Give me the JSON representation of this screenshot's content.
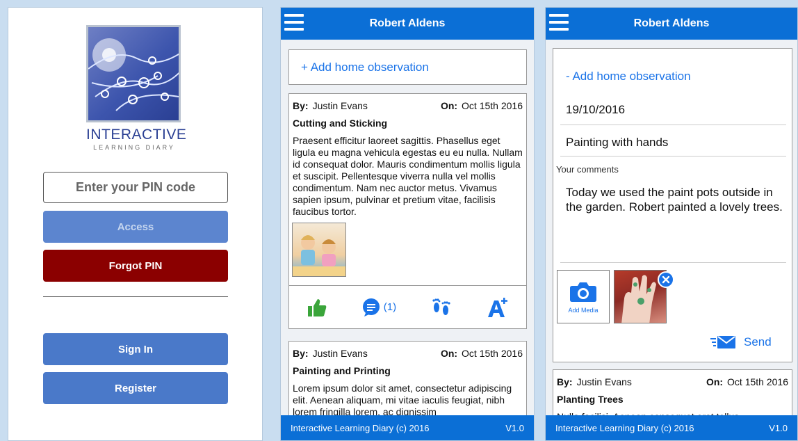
{
  "login": {
    "logo_title": "INTERACTIVE",
    "logo_subtitle": "LEARNING DIARY",
    "pin_placeholder": "Enter your PIN code",
    "access_label": "Access",
    "forgot_label": "Forgot PIN",
    "signin_label": "Sign In",
    "register_label": "Register"
  },
  "feed": {
    "header_title": "Robert Aldens",
    "add_observation": "+ Add home observation",
    "posts": [
      {
        "by_label": "By:",
        "author": "Justin Evans",
        "on_label": "On:",
        "date": "Oct 15th 2016",
        "title": "Cutting and Sticking",
        "body": "Praesent efficitur laoreet sagittis. Phasellus eget ligula eu magna vehicula egestas eu eu nulla. Nullam id consequat dolor. Mauris condimentum mollis ligula et suscipit. Pellentesque viverra nulla vel mollis condimentum. Nam nec auctor metus. Vivamus sapien ipsum, pulvinar et pretium vitae, facilisis faucibus tortor.",
        "comment_count": "(1)"
      },
      {
        "by_label": "By:",
        "author": "Justin Evans",
        "on_label": "On:",
        "date": "Oct 15th 2016",
        "title": "Painting and Printing",
        "body": "Lorem ipsum dolor sit amet, consectetur adipiscing elit. Aenean aliquam, mi vitae iaculis feugiat, nibh lorem fringilla lorem, ac dignissim"
      }
    ],
    "footer_text": "Interactive Learning Diary (c) 2016",
    "footer_version": "V1.0"
  },
  "form": {
    "header_title": "Robert Aldens",
    "toggle_observation": "- Add home observation",
    "date_value": "19/10/2016",
    "title_value": "Painting with hands",
    "comments_label": "Your comments",
    "comments_value": "Today we used the paint pots outside in the garden. Robert painted a lovely trees.",
    "add_media_label": "Add Media",
    "send_label": "Send",
    "post": {
      "by_label": "By:",
      "author": "Justin Evans",
      "on_label": "On:",
      "date": "Oct 15th 2016",
      "title": "Planting Trees",
      "body": "Nulla facilisi. Aenean consequat erat tellus,"
    },
    "footer_text": "Interactive Learning Diary (c) 2016",
    "footer_version": "V1.0"
  },
  "colors": {
    "header_blue": "#0b6fd6",
    "button_blue": "#4a79c9",
    "forgot_red": "#8b0000",
    "like_green": "#3aa53a",
    "link_blue": "#1a73e8"
  }
}
